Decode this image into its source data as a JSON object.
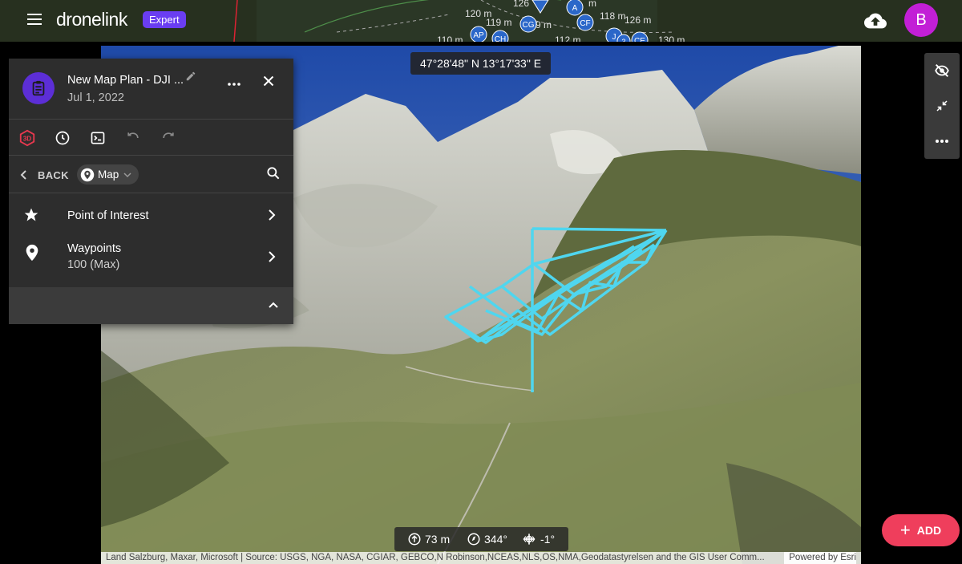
{
  "app": {
    "brand": "dronelink",
    "plan_badge": "Expert",
    "avatar_initial": "B"
  },
  "topbar_map_labels": [
    "120 m",
    "119 m",
    "110 m",
    "112 m",
    "118 m",
    "126 m",
    "130 m",
    "126",
    "9 m",
    "m"
  ],
  "topbar_markers": [
    "AP",
    "CH",
    "CG",
    "CF",
    "A",
    "J",
    "CE",
    "3"
  ],
  "map": {
    "coordinates": "47°28'48\" N 13°17'33\" E",
    "altitude": "73 m",
    "heading": "344°",
    "gimbal_pitch": "-1°",
    "attribution": "Land Salzburg, Maxar, Microsoft | Source: USGS, NGA, NASA, CGIAR, GEBCO,N Robinson,NCEAS,NLS,OS,NMA,Geodatastyrelsen and the GIS User Comm...",
    "powered_by": "Powered by Esri",
    "path_color": "#4fd6ef"
  },
  "panel": {
    "title": "New Map Plan - DJI ...",
    "date": "Jul 1, 2022",
    "back_label": "BACK",
    "context_chip": "Map",
    "items": [
      {
        "title": "Point of Interest",
        "icon": "star-icon"
      },
      {
        "title": "Waypoints",
        "subtitle": "100 (Max)",
        "icon": "map-pin-icon"
      }
    ]
  },
  "actions": {
    "add_label": "ADD"
  },
  "colors": {
    "accent_purple": "#6a3df2",
    "avatar": "#c21fd6",
    "add_button": "#ef3e5c",
    "icon_3d": "#e8384f"
  }
}
